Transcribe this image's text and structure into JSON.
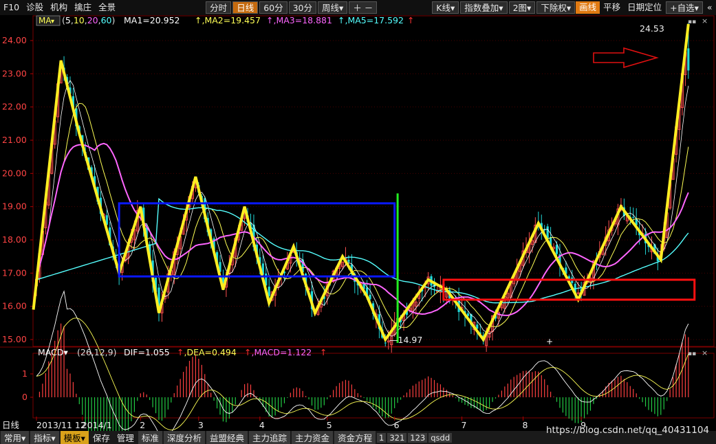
{
  "toolbar": {
    "f10": "F10",
    "items": [
      "诊股",
      "机构",
      "擒庄",
      "全景"
    ],
    "period_tabs": [
      "分时",
      "日线",
      "60分",
      "30分",
      "周线"
    ],
    "active_period": "日线",
    "right_items": [
      "K线",
      "指数叠加",
      "2图",
      "下除权",
      "画线",
      "平移",
      "日期定位",
      "+自选"
    ]
  },
  "chart_data": {
    "type": "candlestick",
    "main_panel": {
      "indicator": "MA",
      "params": "(5,10,20,60)",
      "legend": [
        {
          "label": "MA1=20.952",
          "color": "#ffffff"
        },
        {
          "label": "MA2=19.457",
          "color": "#ffff55"
        },
        {
          "label": "MA3=18.881",
          "color": "#ff66ff"
        },
        {
          "label": "MA5=17.592",
          "color": "#55ffff"
        }
      ],
      "y_ticks": [
        "24.00",
        "23.00",
        "22.00",
        "21.00",
        "20.00",
        "19.00",
        "18.00",
        "17.00",
        "16.00",
        "15.00"
      ],
      "y_range": [
        14.9,
        24.53
      ],
      "x_ticks": [
        "2013/11 12",
        "2014/1",
        "2",
        "3",
        "4",
        "5",
        "6",
        "7",
        "8",
        "9"
      ],
      "x_tick_index": [
        0,
        15,
        34,
        53,
        73,
        95,
        117,
        139,
        159,
        178
      ],
      "high_label": "24.53",
      "low_label": "14.97",
      "zigzag_points": [
        [
          -1,
          15.9
        ],
        [
          8,
          23.4
        ],
        [
          14,
          21.2
        ],
        [
          27,
          17.0
        ],
        [
          34,
          19.0
        ],
        [
          40,
          15.8
        ],
        [
          52,
          19.9
        ],
        [
          61,
          16.5
        ],
        [
          68,
          19.0
        ],
        [
          76,
          16.1
        ],
        [
          84,
          17.8
        ],
        [
          91,
          15.8
        ],
        [
          100,
          17.5
        ],
        [
          108,
          16.3
        ],
        [
          114,
          15.0
        ],
        [
          128,
          16.8
        ],
        [
          134,
          16.5
        ],
        [
          146,
          15.0
        ],
        [
          164,
          18.5
        ],
        [
          177,
          16.2
        ],
        [
          191,
          19.0
        ],
        [
          204,
          17.4
        ],
        [
          213,
          24.5
        ]
      ],
      "boxes": [
        {
          "color": "#0a18ff",
          "x0": 27,
          "x1": 117,
          "y0": 16.9,
          "y1": 19.1
        },
        {
          "color": "#ff1010",
          "x0": 133,
          "x1": 215,
          "y0": 16.2,
          "y1": 16.8
        }
      ],
      "vertical_line": {
        "color": "#22ee22",
        "x": 118,
        "y0": 14.9,
        "y1": 19.4
      }
    },
    "macd_panel": {
      "indicator": "MACD",
      "params": "(26,12,9)",
      "legend": [
        {
          "label": "DIF=1.055",
          "color": "#ffffff"
        },
        {
          "label": "DEA=0.494",
          "color": "#ffff55"
        },
        {
          "label": "MACD=1.122",
          "color": "#ff66ff"
        }
      ],
      "y_ticks": [
        "1",
        "0"
      ],
      "y_range": [
        -0.9,
        1.6
      ]
    }
  },
  "bottom": {
    "period_label": "日线",
    "tabs": [
      "常用",
      "指标",
      "模板"
    ],
    "active_tab": "模板",
    "items": [
      "保存",
      "管理",
      "标准",
      "深度分析",
      "益盟经典",
      "主力追踪",
      "主力资金",
      "资金方程"
    ],
    "small": [
      "1",
      "321",
      "123",
      "qsdd"
    ]
  },
  "watermark": "https://blog.csdn.net/qq_40431104"
}
